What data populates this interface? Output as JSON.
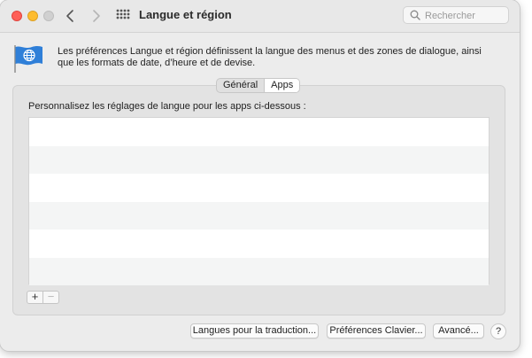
{
  "window": {
    "title": "Langue et région"
  },
  "search": {
    "placeholder": "Rechercher",
    "icon": "search-icon"
  },
  "header": {
    "description": "Les préférences Langue et région définissent la langue des menus et des zones de dialogue, ainsi que les formats de date, d’heure et de devise."
  },
  "tabs": [
    {
      "label": "Général",
      "active": false
    },
    {
      "label": "Apps",
      "active": true
    }
  ],
  "apps_pane": {
    "prompt": "Personnalisez les réglages de langue pour les apps ci-dessous :",
    "rows": [
      "",
      "",
      "",
      "",
      "",
      ""
    ],
    "add_label": "+",
    "remove_label": "−"
  },
  "footer": {
    "translation_languages": "Langues pour la traduction...",
    "keyboard_prefs": "Préférences Clavier...",
    "advanced": "Avancé...",
    "help": "?"
  },
  "colors": {
    "close": "#ff5f57",
    "minimize": "#febc2e",
    "zoom": "#d0d0d0",
    "flag_blue": "#2f7fd8"
  }
}
